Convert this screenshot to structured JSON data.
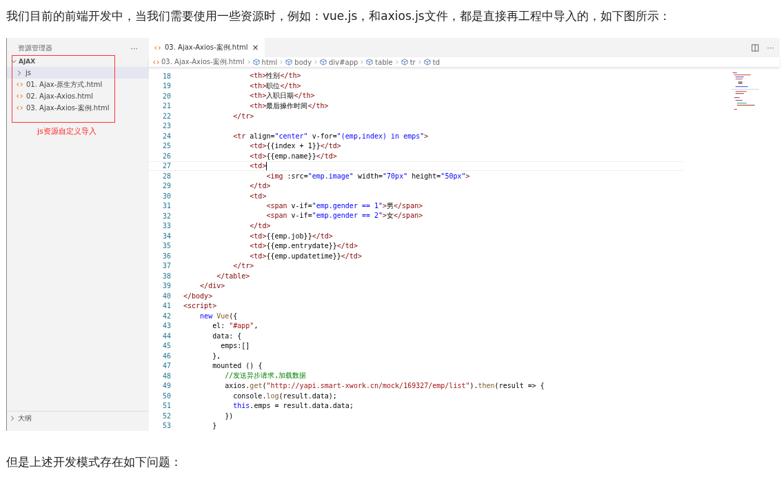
{
  "intro": "我们目前的前端开发中，当我们需要使用一些资源时，例如：vue.js，和axios.js文件，都是直接再工程中导入的，如下图所示：",
  "editor": {
    "sidebar": {
      "title": "资源管理器",
      "more": "···",
      "root": {
        "label": "AJAX",
        "expanded": true,
        "children": [
          {
            "kind": "folder",
            "label": "js",
            "expanded": false,
            "selected": true
          },
          {
            "kind": "file",
            "label": "01. Ajax-原生方式.html",
            "selected": false
          },
          {
            "kind": "file",
            "label": "02. Ajax-Axios.html",
            "selected": false
          },
          {
            "kind": "file",
            "label": "03. Ajax-Axios-案例.html",
            "selected": false
          }
        ]
      },
      "annotation": "js资源自定义导入",
      "sections": [
        {
          "label": "大纲",
          "expanded": false
        }
      ]
    },
    "tabs": [
      {
        "label": "03. Ajax-Axios-案例.html",
        "close": "×",
        "selected": true
      }
    ],
    "more": "···",
    "breadcrumbs": [
      "03. Ajax-Axios-案例.html",
      "html",
      "body",
      "div#app",
      "table",
      "tr",
      "td"
    ],
    "lines": [
      {
        "number": "18",
        "kind": "html",
        "text": "                <th>性别</th>"
      },
      {
        "number": "19",
        "kind": "html",
        "text": "                <th>职位</th>"
      },
      {
        "number": "20",
        "kind": "html",
        "text": "                <th>入职日期</th>"
      },
      {
        "number": "21",
        "kind": "html",
        "text": "                <th>最后操作时间</th>"
      },
      {
        "number": "22",
        "kind": "html",
        "text": "            </tr>"
      },
      {
        "number": "23"
      },
      {
        "number": "24",
        "kind": "html",
        "text": "            <tr align=\"center\" v-for=\"(emp,index) in emps\">"
      },
      {
        "number": "25",
        "kind": "html",
        "text": "                <td>{{index + 1}}</td>"
      },
      {
        "number": "26",
        "kind": "html",
        "text": "                <td>{{emp.name}}</td>"
      },
      {
        "number": "27",
        "kind": "html",
        "text": "                <td>",
        "current": true
      },
      {
        "number": "28",
        "kind": "html",
        "text": "                    <img :src=\"emp.image\" width=\"70px\" height=\"50px\">"
      },
      {
        "number": "29",
        "kind": "html",
        "text": "                </td>"
      },
      {
        "number": "30",
        "kind": "html",
        "text": "                <td>"
      },
      {
        "number": "31",
        "kind": "html",
        "text": "                    <span v-if=\"emp.gender == 1\">男</span>"
      },
      {
        "number": "32",
        "kind": "html",
        "text": "                    <span v-if=\"emp.gender == 2\">女</span>"
      },
      {
        "number": "33",
        "kind": "html",
        "text": "                </td>"
      },
      {
        "number": "34",
        "kind": "html",
        "text": "                <td>{{emp.job}}</td>"
      },
      {
        "number": "35",
        "kind": "html",
        "text": "                <td>{{emp.entrydate}}</td>"
      },
      {
        "number": "36",
        "kind": "html",
        "text": "                <td>{{emp.updatetime}}</td>"
      },
      {
        "number": "37",
        "kind": "html",
        "text": "            </tr>"
      },
      {
        "number": "38",
        "kind": "html",
        "text": "        </table>"
      },
      {
        "number": "39",
        "kind": "html",
        "text": "    </div>"
      },
      {
        "number": "40",
        "kind": "html",
        "text": "</body>"
      },
      {
        "number": "41",
        "kind": "html",
        "text": "<script>"
      },
      {
        "number": "42",
        "kind": "js",
        "text": "    new Vue({"
      },
      {
        "number": "43",
        "kind": "js",
        "text": "       el: \"#app\","
      },
      {
        "number": "44",
        "kind": "js",
        "text": "       data: {"
      },
      {
        "number": "45",
        "kind": "js",
        "text": "         emps:[]"
      },
      {
        "number": "46",
        "kind": "js",
        "text": "       },"
      },
      {
        "number": "47",
        "kind": "js",
        "text": "       mounted () {"
      },
      {
        "number": "48",
        "kind": "js",
        "text": "          //发送异步请求,加载数据"
      },
      {
        "number": "49",
        "kind": "js",
        "text": "          axios.get(\"http://yapi.smart-xwork.cn/mock/169327/emp/list\").then(result => {"
      },
      {
        "number": "50",
        "kind": "js",
        "text": "            console.log(result.data);"
      },
      {
        "number": "51",
        "kind": "js",
        "text": "            this.emps = result.data.data;"
      },
      {
        "number": "52",
        "kind": "js",
        "text": "          })"
      },
      {
        "number": "53",
        "kind": "js",
        "text": "       }"
      }
    ]
  },
  "outro": "但是上述开发模式存在如下问题："
}
